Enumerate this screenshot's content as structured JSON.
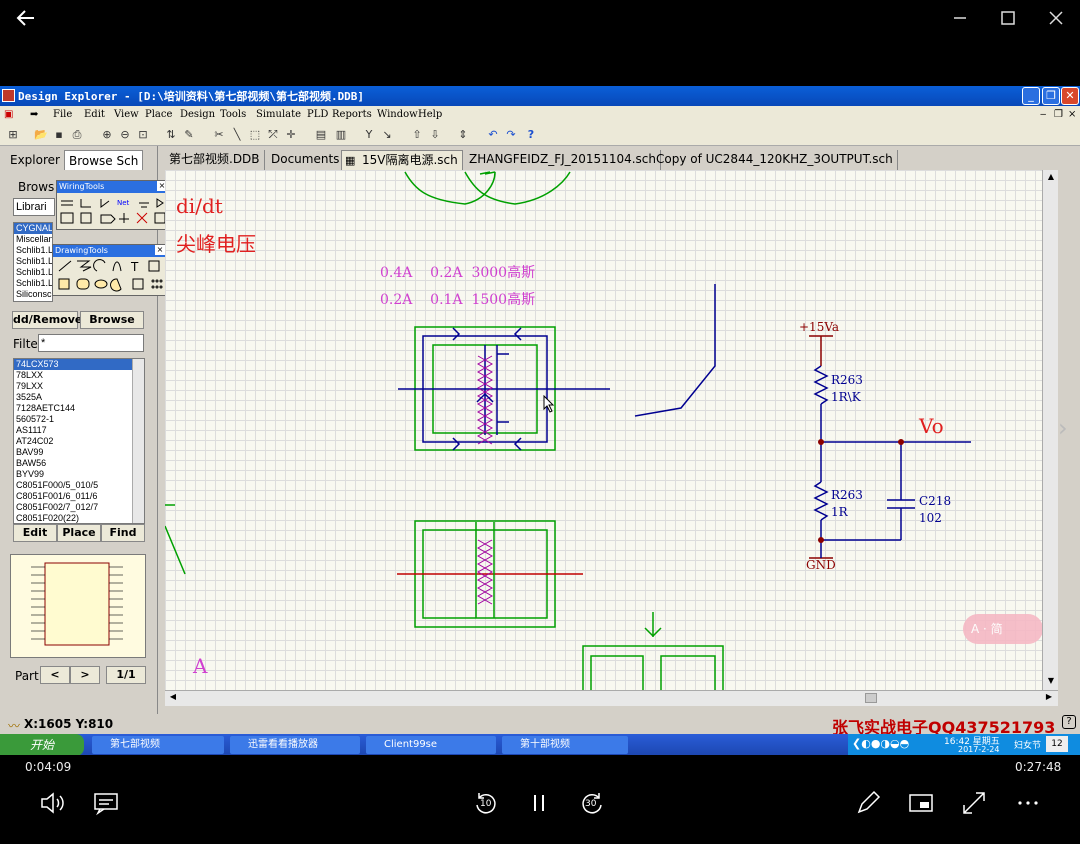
{
  "player": {
    "elapsed": "0:04:09",
    "remaining": "0:27:48",
    "rewind_label": "10",
    "forward_label": "30"
  },
  "app": {
    "title": "Design Explorer - [D:\\培训资料\\第七部视频\\第七部视频.DDB]",
    "menu": [
      "File",
      "Edit",
      "View",
      "Place",
      "Design",
      "Tools",
      "Simulate",
      "PLD",
      "Reports",
      "Window",
      "Help"
    ]
  },
  "left_panel": {
    "tabs": [
      "Explorer",
      "Browse Sch"
    ],
    "browse_label": "Brows",
    "library_select": "Librari",
    "libraries": [
      "CYGNAL",
      "Miscellaneous Devices.lib",
      "Schlib1.L",
      "Schlib1.L",
      "Schlib1.L",
      "Schlib1.L",
      "Siliconsc"
    ],
    "add_remove_label": "dd/Remove",
    "browse_button": "Browse",
    "filter_label": "Filte",
    "filter_value": "*",
    "components": [
      "74LCX573",
      "78LXX",
      "79LXX",
      "3525A",
      "7128AETC144",
      "560572-1",
      "AS1117",
      "AT24C02",
      "BAV99",
      "BAW56",
      "BYV99",
      "C8051F000/5_010/5",
      "C8051F001/6_011/6",
      "C8051F002/7_012/7",
      "C8051F020(22)"
    ],
    "edit_button": "Edit",
    "place_button": "Place",
    "find_button": "Find",
    "part_label": "Part",
    "part_page": "1/1"
  },
  "palettes": {
    "wiring": "WiringTools",
    "drawing": "DrawingTools"
  },
  "doc_tabs": [
    "第七部视频.DDB",
    "Documents",
    "15V隔离电源.sch",
    "ZHANGFEIDZ_FJ_20151104.sch",
    "Copy of UC2844_120KHZ_3OUTPUT.sch"
  ],
  "schematic": {
    "note_red_1": "di/dt",
    "note_red_2": "尖峰电压",
    "note_pink_1": "0.4A    0.2A  3000高斯",
    "note_pink_2": "0.2A    0.1A  1500高斯",
    "letter_a": "A",
    "vcc": "+15Va",
    "r1_ref": "R263",
    "r1_val": "1R\\K",
    "r2_ref": "R263",
    "r2_val": "1R",
    "c_ref": "C218",
    "c_val": "102",
    "gnd": "GND",
    "vo": "Vo",
    "watermark": "张飞实战电子QQ437521793",
    "badge": "A · 简"
  },
  "status": {
    "coords": "X:1605 Y:810"
  },
  "taskbar": {
    "start": "开始",
    "items": [
      "第七部视频",
      "迅雷看看播放器",
      "Client99se",
      "第十部视频"
    ],
    "time": "16:42 星期五",
    "date": "2017-2-24",
    "holiday": "妇女节",
    "day": "12"
  },
  "colors": {
    "green_wire": "#00a000",
    "blue_wire": "#000090",
    "red_note": "#e02020",
    "pink_note": "#d040d0",
    "component": "#000090",
    "net_red": "#c00000"
  }
}
